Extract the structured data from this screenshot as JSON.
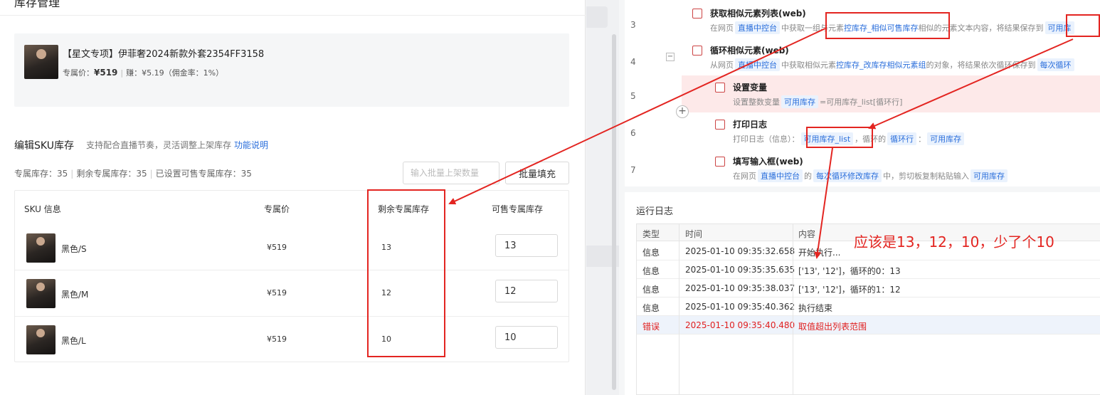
{
  "modal": {
    "title": "库存管理",
    "close": "×",
    "product": {
      "name": "【星文专项】伊菲奢2024新款外套2354FF3158",
      "price_label": "专属价：",
      "price": "¥519",
      "earn": "赚：¥5.19（佣金率：1%）"
    },
    "sku_title": "编辑SKU库存",
    "sku_subtitle": "支持配合直播节奏，灵活调整上架库存",
    "sku_help": "功能说明",
    "summary": {
      "exclusive": "专属库存：35",
      "remaining": "剩余专属库存：35",
      "set_sellable": "已设置可售专属库存：35"
    },
    "bulk_placeholder": "输入批量上架数量",
    "bulk_button": "批量填充",
    "table": {
      "headers": [
        "SKU 信息",
        "专属价",
        "剩余专属库存",
        "可售专属库存"
      ],
      "rows": [
        {
          "spec": "黑色/S",
          "price": "¥519",
          "remaining": "13",
          "sellable": "13"
        },
        {
          "spec": "黑色/M",
          "price": "¥519",
          "remaining": "12",
          "sellable": "12"
        },
        {
          "spec": "黑色/L",
          "price": "¥519",
          "remaining": "10",
          "sellable": "10"
        }
      ]
    }
  },
  "flow": {
    "steps": [
      {
        "num": "3",
        "title": "获取相似元素列表(web)",
        "desc_prefix": "在网页",
        "tag1": "直播中控台",
        "desc_mid": "中获取一组与元素",
        "link": "控库存_相似可售库存",
        "desc_mid2": "相似的元素文本内容，将结果保存到",
        "tag2": "可用库"
      },
      {
        "num": "4",
        "title": "循环相似元素(web)",
        "desc_prefix": "从网页",
        "tag1": "直播中控台",
        "desc_mid": "中获取相似元素",
        "link": "控库存_改库存相似元素组",
        "desc_mid2": "的对象，将结果依次循环保存到",
        "tag2": "每次循环"
      },
      {
        "num": "5",
        "title": "设置变量",
        "desc_prefix": "设置整数变量",
        "tag1": "可用库存",
        "desc_mid": "=可用库存_list[循环行]"
      },
      {
        "num": "6",
        "title": "打印日志",
        "desc_prefix": "打印日志（信息）：",
        "tag1": "可用库存_list",
        "desc_mid": "，循环的",
        "tag2": "循环行",
        "desc_mid2": "：",
        "tag3": "可用库存"
      },
      {
        "num": "7",
        "title": "填写输入框(web)",
        "desc_prefix": "在网页",
        "tag1": "直播中控台",
        "desc_mid": "的",
        "tag2": "每次循环修改库存",
        "desc_mid2": "中，剪切板复制粘贴输入",
        "tag3": "可用库存"
      }
    ],
    "collapse": "−",
    "add": "+"
  },
  "log": {
    "title": "运行日志",
    "headers": [
      "类型",
      "时间",
      "内容"
    ],
    "rows": [
      {
        "type": "信息",
        "time": "2025-01-10 09:35:32.658",
        "content": "开始执行..."
      },
      {
        "type": "信息",
        "time": "2025-01-10 09:35:35.635",
        "content": "['13', '12']，循环的0：13"
      },
      {
        "type": "信息",
        "time": "2025-01-10 09:35:38.037",
        "content": "['13', '12']，循环的1：12"
      },
      {
        "type": "信息",
        "time": "2025-01-10 09:35:40.362",
        "content": "执行结束"
      },
      {
        "type": "错误",
        "time": "2025-01-10 09:35:40.480",
        "content": "取值超出列表范围"
      }
    ]
  },
  "annotation": {
    "note": "应该是13，12，10，少了个10",
    "color": "#e32521"
  }
}
